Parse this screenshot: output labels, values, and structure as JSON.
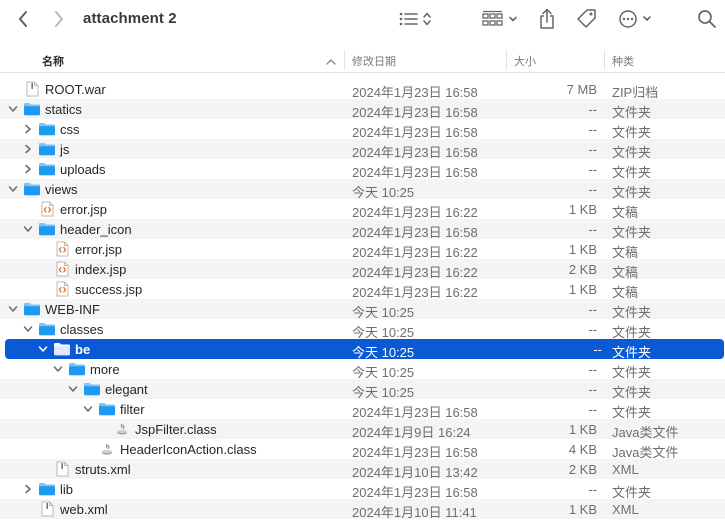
{
  "window": {
    "title": "attachment 2"
  },
  "columns": {
    "name": "名称",
    "date": "修改日期",
    "size": "大小",
    "kind": "种类"
  },
  "rows": [
    {
      "name": "ROOT.war",
      "date": "2024年1月23日 16:58",
      "size": "7 MB",
      "kind": "ZIP归档",
      "depth": 0,
      "chevron": "none",
      "icon": "file"
    },
    {
      "name": "statics",
      "date": "2024年1月23日 16:58",
      "size": "--",
      "kind": "文件夹",
      "depth": 0,
      "chevron": "down",
      "icon": "folder"
    },
    {
      "name": "css",
      "date": "2024年1月23日 16:58",
      "size": "--",
      "kind": "文件夹",
      "depth": 1,
      "chevron": "right",
      "icon": "folder"
    },
    {
      "name": "js",
      "date": "2024年1月23日 16:58",
      "size": "--",
      "kind": "文件夹",
      "depth": 1,
      "chevron": "right",
      "icon": "folder"
    },
    {
      "name": "uploads",
      "date": "2024年1月23日 16:58",
      "size": "--",
      "kind": "文件夹",
      "depth": 1,
      "chevron": "right",
      "icon": "folder"
    },
    {
      "name": "views",
      "date": "今天 10:25",
      "size": "--",
      "kind": "文件夹",
      "depth": 0,
      "chevron": "down",
      "icon": "folder"
    },
    {
      "name": "error.jsp",
      "date": "2024年1月23日 16:22",
      "size": "1 KB",
      "kind": "文稿",
      "depth": 1,
      "chevron": "none",
      "icon": "jsp"
    },
    {
      "name": "header_icon",
      "date": "2024年1月23日 16:58",
      "size": "--",
      "kind": "文件夹",
      "depth": 1,
      "chevron": "down",
      "icon": "folder"
    },
    {
      "name": "error.jsp",
      "date": "2024年1月23日 16:22",
      "size": "1 KB",
      "kind": "文稿",
      "depth": 2,
      "chevron": "none",
      "icon": "jsp"
    },
    {
      "name": "index.jsp",
      "date": "2024年1月23日 16:22",
      "size": "2 KB",
      "kind": "文稿",
      "depth": 2,
      "chevron": "none",
      "icon": "jsp"
    },
    {
      "name": "success.jsp",
      "date": "2024年1月23日 16:22",
      "size": "1 KB",
      "kind": "文稿",
      "depth": 2,
      "chevron": "none",
      "icon": "jsp"
    },
    {
      "name": "WEB-INF",
      "date": "今天 10:25",
      "size": "--",
      "kind": "文件夹",
      "depth": 0,
      "chevron": "down",
      "icon": "folder"
    },
    {
      "name": "classes",
      "date": "今天 10:25",
      "size": "--",
      "kind": "文件夹",
      "depth": 1,
      "chevron": "down",
      "icon": "folder"
    },
    {
      "name": "be",
      "date": "今天 10:25",
      "size": "--",
      "kind": "文件夹",
      "depth": 2,
      "chevron": "down",
      "icon": "folder",
      "selected": true
    },
    {
      "name": "more",
      "date": "今天 10:25",
      "size": "--",
      "kind": "文件夹",
      "depth": 3,
      "chevron": "down",
      "icon": "folder"
    },
    {
      "name": "elegant",
      "date": "今天 10:25",
      "size": "--",
      "kind": "文件夹",
      "depth": 4,
      "chevron": "down",
      "icon": "folder"
    },
    {
      "name": "filter",
      "date": "2024年1月23日 16:58",
      "size": "--",
      "kind": "文件夹",
      "depth": 5,
      "chevron": "down",
      "icon": "folder"
    },
    {
      "name": "JspFilter.class",
      "date": "2024年1月9日 16:24",
      "size": "1 KB",
      "kind": "Java类文件",
      "depth": 6,
      "chevron": "none",
      "icon": "java"
    },
    {
      "name": "HeaderIconAction.class",
      "date": "2024年1月23日 16:58",
      "size": "4 KB",
      "kind": "Java类文件",
      "depth": 5,
      "chevron": "none",
      "icon": "java"
    },
    {
      "name": "struts.xml",
      "date": "2024年1月10日 13:42",
      "size": "2 KB",
      "kind": "XML",
      "depth": 2,
      "chevron": "none",
      "icon": "file"
    },
    {
      "name": "lib",
      "date": "2024年1月23日 16:58",
      "size": "--",
      "kind": "文件夹",
      "depth": 1,
      "chevron": "right",
      "icon": "folder"
    },
    {
      "name": "web.xml",
      "date": "2024年1月10日 11:41",
      "size": "1 KB",
      "kind": "XML",
      "depth": 1,
      "chevron": "none",
      "icon": "file"
    }
  ],
  "colors": {
    "accent": "#0a5ad6",
    "folder": "#1e9bf0"
  }
}
